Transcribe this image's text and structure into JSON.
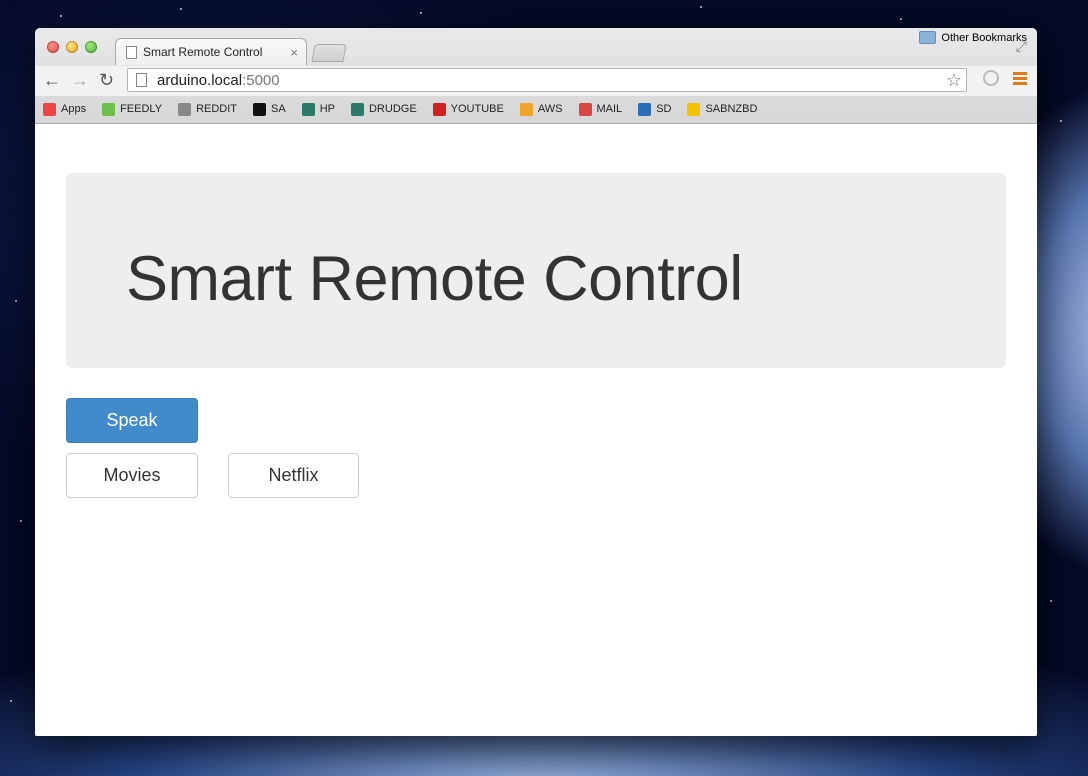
{
  "browser": {
    "tab_title": "Smart Remote Control",
    "tab_close": "×",
    "url_host": "arduino.local",
    "url_port": ":5000",
    "bookmarks": [
      {
        "label": "Apps",
        "icon": "apps-grid-icon",
        "color": "#e44"
      },
      {
        "label": "FEEDLY",
        "icon": "feedly-icon",
        "color": "#6cc04a"
      },
      {
        "label": "REDDIT",
        "icon": "reddit-icon",
        "color": "#888"
      },
      {
        "label": "SA",
        "icon": "grenade-icon",
        "color": "#111"
      },
      {
        "label": "HP",
        "icon": "hp-icon",
        "color": "#2a7a6a"
      },
      {
        "label": "DRUDGE",
        "icon": "drudge-icon",
        "color": "#2a7a6a"
      },
      {
        "label": "YOUTUBE",
        "icon": "youtube-icon",
        "color": "#d21f1f"
      },
      {
        "label": "AWS",
        "icon": "aws-icon",
        "color": "#f0a52a"
      },
      {
        "label": "MAIL",
        "icon": "gmail-icon",
        "color": "#d44"
      },
      {
        "label": "SD",
        "icon": "sd-icon",
        "color": "#2a6fb5"
      },
      {
        "label": "SABNZBD",
        "icon": "sabnzbd-icon",
        "color": "#f2c200"
      }
    ],
    "other_bookmarks": "Other Bookmarks"
  },
  "page": {
    "heading": "Smart Remote Control",
    "buttons": {
      "speak": "Speak",
      "movies": "Movies",
      "netflix": "Netflix"
    }
  }
}
